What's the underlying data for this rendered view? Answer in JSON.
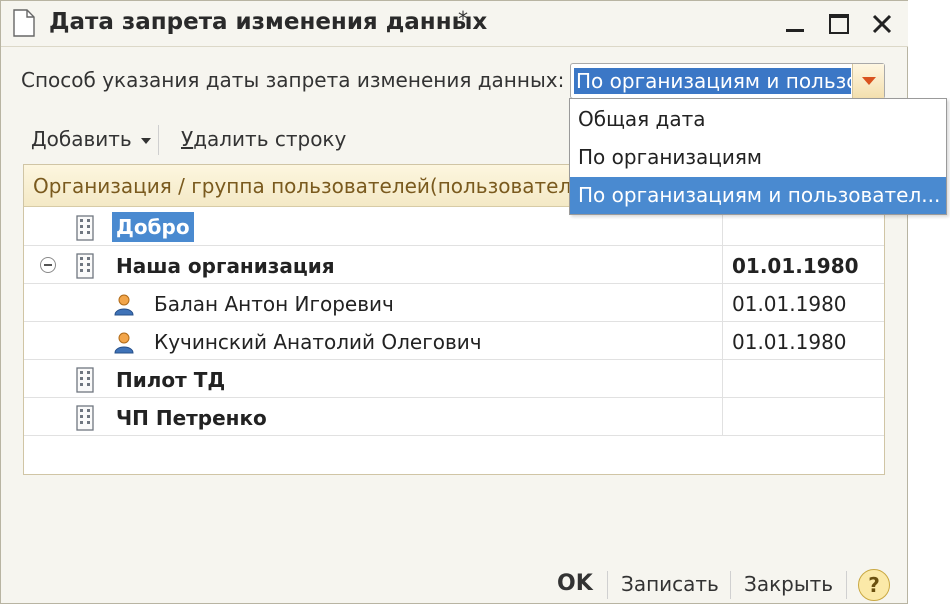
{
  "window": {
    "title": "Дата запрета изменения данных",
    "modified_mark": "*"
  },
  "mode": {
    "label": "Способ указания даты запрета изменения данных:",
    "selected_value": "По организациям и пользо",
    "options": [
      "Общая дата",
      "По организациям",
      "По организациям и пользовател..."
    ],
    "selected_index": 2
  },
  "toolbar": {
    "add_label": "Добавить",
    "delete_label_underlined": "У",
    "delete_label_rest": "далить строку"
  },
  "table": {
    "header": "Организация / группа пользователей(пользователь)",
    "rows": [
      {
        "name": "Добро",
        "date": "",
        "type": "org",
        "bold": true,
        "selected": true
      },
      {
        "name": "Наша организация",
        "date": "01.01.1980",
        "type": "org",
        "bold": true,
        "expanded": true
      },
      {
        "name": "Балан Антон Игоревич",
        "date": "01.01.1980",
        "type": "user",
        "bold": false
      },
      {
        "name": "Кучинский Анатолий Олегович",
        "date": "01.01.1980",
        "type": "user",
        "bold": false
      },
      {
        "name": "Пилот ТД",
        "date": "",
        "type": "org",
        "bold": true
      },
      {
        "name": "ЧП Петренко",
        "date": "",
        "type": "org",
        "bold": true
      }
    ]
  },
  "footer": {
    "ok_label": "OK",
    "save_label": "Записать",
    "close_label": "Закрыть",
    "help_label": "?"
  },
  "colors": {
    "selection": "#4a8ad0",
    "header_text": "#7a5a1e",
    "window_bg": "#f6f5ef",
    "dropdown_arrow": "#d9531e"
  },
  "icons": {
    "document": "document-icon",
    "minimize": "minimize-icon",
    "maximize": "maximize-icon",
    "close": "close-icon",
    "organization": "building-icon",
    "user": "user-icon",
    "collapse": "collapse-icon",
    "help": "help-icon"
  }
}
